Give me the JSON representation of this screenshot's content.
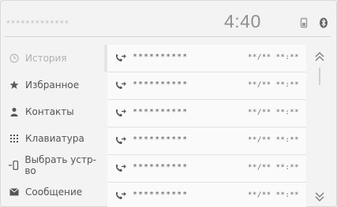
{
  "status_bar": {
    "device_name": "*************",
    "clock": "4:40",
    "phone_icon": "phone-battery-icon",
    "bluetooth_icon": "bluetooth-icon"
  },
  "sidebar": {
    "items": [
      {
        "label": "История",
        "icon": "clock-icon",
        "active": true
      },
      {
        "label": "Избранное",
        "icon": "star-icon",
        "active": false
      },
      {
        "label": "Контакты",
        "icon": "person-icon",
        "active": false
      },
      {
        "label": "Клавиатура",
        "icon": "keypad-icon",
        "active": false
      },
      {
        "label": "Выбрать устр-во",
        "icon": "device-icon",
        "active": false
      },
      {
        "label": "Сообщение",
        "icon": "message-icon",
        "active": false
      }
    ]
  },
  "call_history": {
    "rows": [
      {
        "number": "**********",
        "datetime": "**/** **:**"
      },
      {
        "number": "**********",
        "datetime": "**/** **:**"
      },
      {
        "number": "**********",
        "datetime": "**/** **:**"
      },
      {
        "number": "**********",
        "datetime": "**/** **:**"
      },
      {
        "number": "**********",
        "datetime": "**/** **:**"
      },
      {
        "number": "**********",
        "datetime": "**/** **:**"
      }
    ]
  },
  "scroll": {
    "up_icon": "double-chevron-up-icon",
    "down_icon": "double-chevron-down-icon"
  },
  "colors": {
    "background": "#f3f3f3",
    "text": "#555555",
    "muted": "#b0b0b0",
    "divider": "#d4d4d4"
  }
}
